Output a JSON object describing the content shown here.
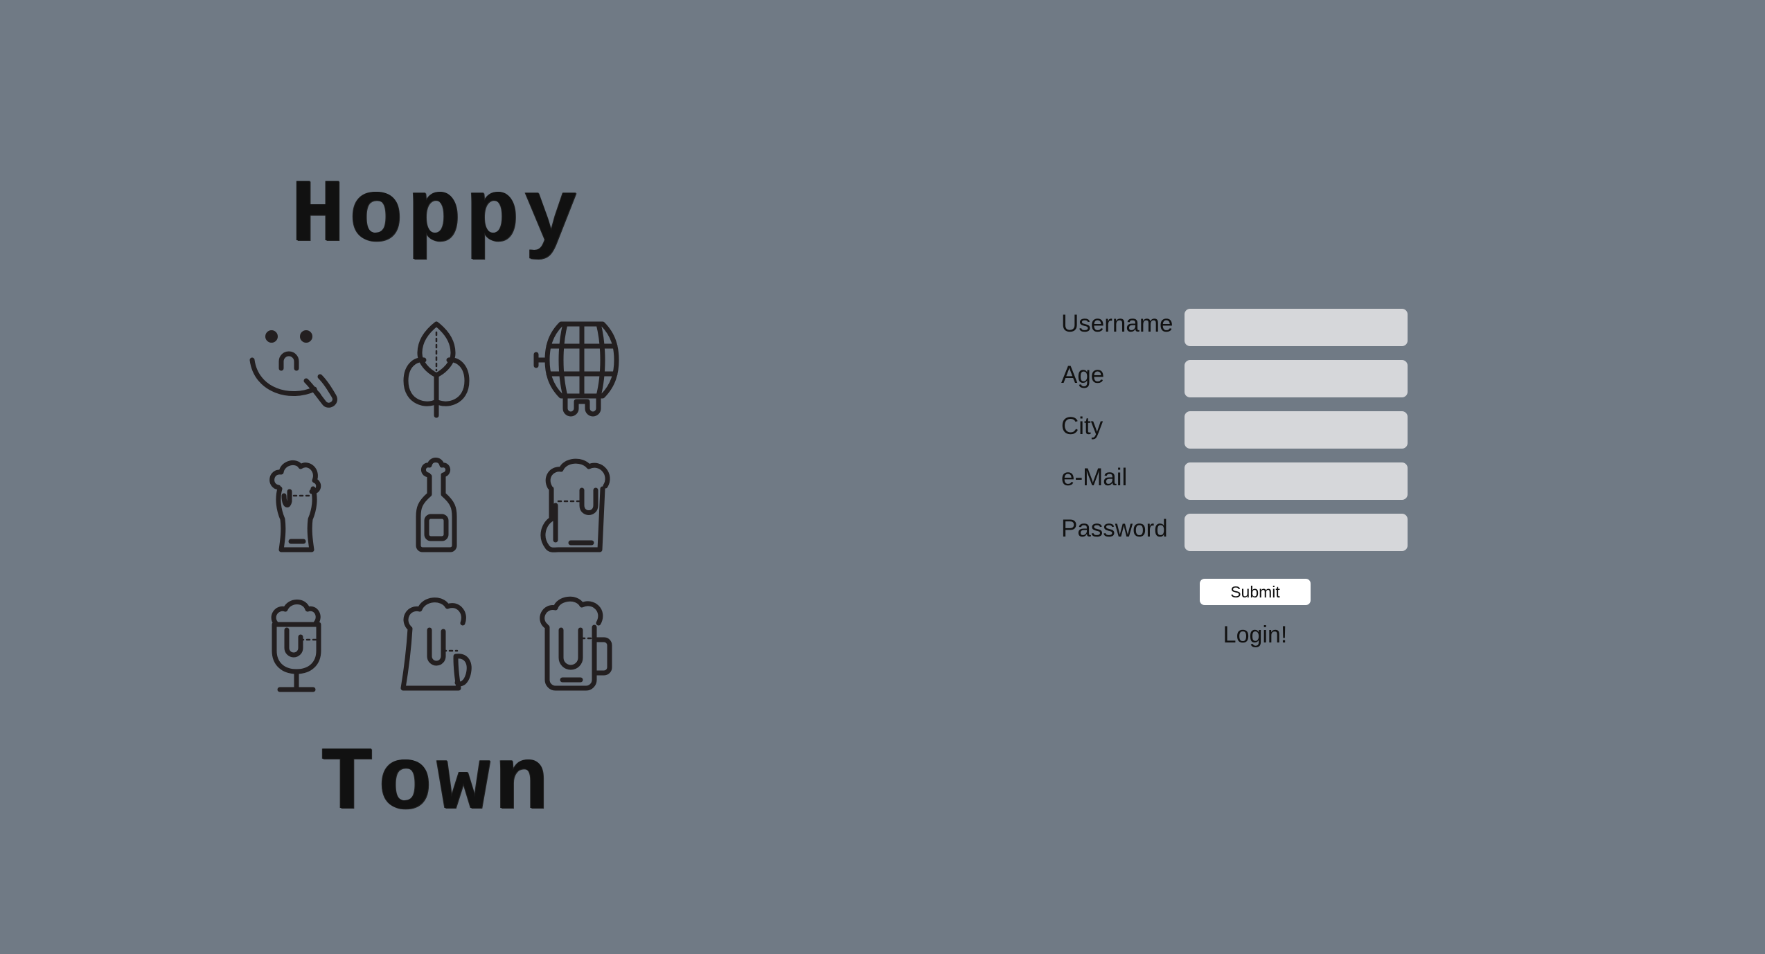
{
  "background_color": "#707a85",
  "logo": {
    "title_top": "Hoppy",
    "title_bottom": "Town",
    "icons": [
      "tongue-out-face-icon",
      "hop-leaf-icon",
      "beer-barrel-icon",
      "pint-glass-icon",
      "beer-bottle-icon",
      "beer-glass-large-icon",
      "goblet-glass-icon",
      "beer-mug-icon",
      "beer-stein-icon"
    ]
  },
  "form": {
    "fields": [
      {
        "label": "Username",
        "value": "",
        "placeholder": ""
      },
      {
        "label": "Age",
        "value": "",
        "placeholder": ""
      },
      {
        "label": "City",
        "value": "",
        "placeholder": ""
      },
      {
        "label": "e-Mail",
        "value": "",
        "placeholder": ""
      },
      {
        "label": "Password",
        "value": "",
        "placeholder": ""
      }
    ],
    "submit_label": "Submit",
    "login_link": "Login!"
  },
  "colors": {
    "input_background": "#d6d7da",
    "button_background": "#ffffff",
    "icon_stroke": "#231f20"
  }
}
